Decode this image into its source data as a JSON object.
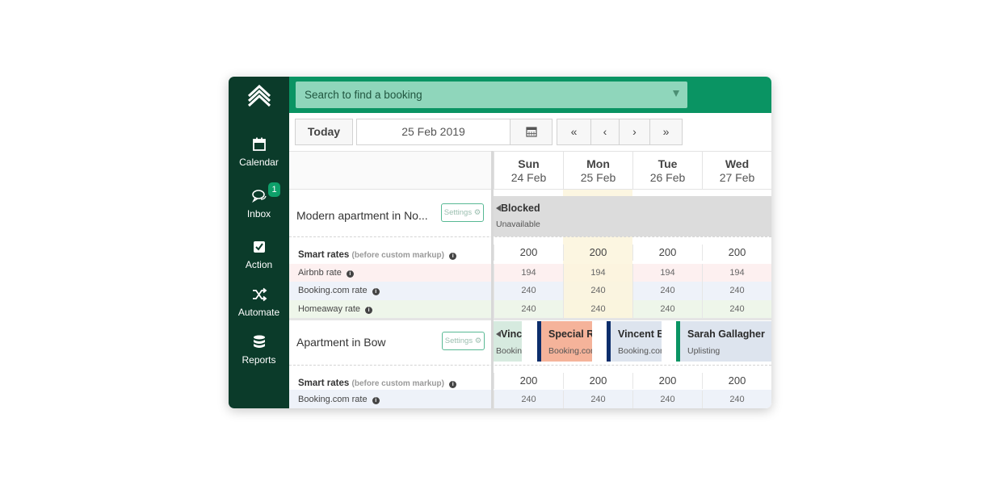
{
  "colors": {
    "sidebar_bg": "#0b3b2a",
    "topbar_bg": "#0a9463",
    "search_bg": "#8fd6bb",
    "airbnb_row": "#fdf0f0",
    "booking_row": "#eef2f9",
    "homeaway_row": "#eef6ea",
    "today_column": "#fbf5dc",
    "blocked_bg": "#dcdcdc",
    "booking_accent": "#0c2d6b",
    "uplisting_accent": "#0a9463"
  },
  "sidebar": {
    "items": [
      {
        "label": "Calendar",
        "icon": "calendar-icon"
      },
      {
        "label": "Inbox",
        "icon": "chat-icon",
        "badge": "1"
      },
      {
        "label": "Action",
        "icon": "checkbox-icon"
      },
      {
        "label": "Automate",
        "icon": "shuffle-icon"
      },
      {
        "label": "Reports",
        "icon": "database-icon"
      }
    ]
  },
  "search": {
    "placeholder": "Search to find a booking"
  },
  "toolbar": {
    "today_label": "Today",
    "date_value": "25 Feb 2019",
    "first": "«",
    "prev": "‹",
    "next": "›",
    "last": "»"
  },
  "days": [
    {
      "name": "Sun",
      "date": "24 Feb"
    },
    {
      "name": "Mon",
      "date": "25 Feb"
    },
    {
      "name": "Tue",
      "date": "26 Feb"
    },
    {
      "name": "Wed",
      "date": "27 Feb"
    }
  ],
  "property1": {
    "name": "Modern apartment in No...",
    "settings_label": "Settings",
    "blocked_title": "Blocked",
    "blocked_sub": "Unavailable",
    "smart_label": "Smart rates",
    "smart_sub": "(before custom markup)",
    "smart_values": [
      "200",
      "200",
      "200",
      "200"
    ],
    "airbnb_label": "Airbnb rate",
    "airbnb_values": [
      "194",
      "194",
      "194",
      "194"
    ],
    "booking_label": "Booking.com rate",
    "booking_values": [
      "240",
      "240",
      "240",
      "240"
    ],
    "homeaway_label": "Homeaway rate",
    "homeaway_values": [
      "240",
      "240",
      "240",
      "240"
    ]
  },
  "property2": {
    "name": "Apartment in Bow",
    "settings_label": "Settings",
    "bookings": [
      {
        "title": "Vince",
        "source": "Booking"
      },
      {
        "title": "Special Re",
        "source": "Booking.com"
      },
      {
        "title": "Vincent B",
        "source": "Booking.com"
      },
      {
        "title": "Sarah Gallagher",
        "source": "Uplisting"
      }
    ],
    "smart_label": "Smart rates",
    "smart_sub": "(before custom markup)",
    "smart_values": [
      "200",
      "200",
      "200",
      "200"
    ],
    "booking_label": "Booking.com rate",
    "booking_values": [
      "240",
      "240",
      "240",
      "240"
    ]
  }
}
